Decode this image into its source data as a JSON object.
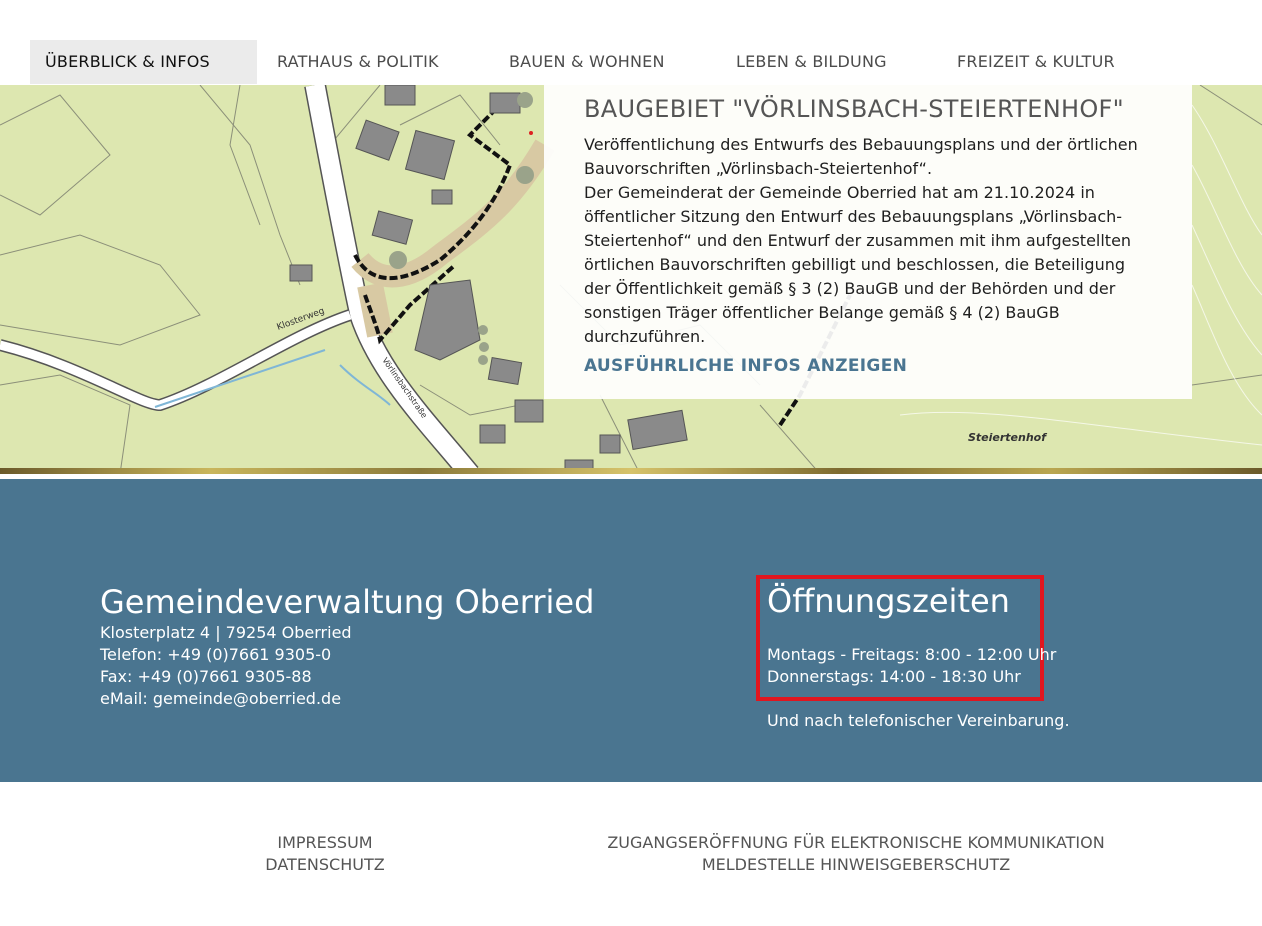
{
  "nav": {
    "items": [
      {
        "label": "ÜBERBLICK & INFOS",
        "active": true
      },
      {
        "label": "RATHAUS & POLITIK"
      },
      {
        "label": "BAUEN & WOHNEN"
      },
      {
        "label": "LEBEN & BILDUNG"
      },
      {
        "label": "FREIZEIT & KULTUR"
      }
    ]
  },
  "hero": {
    "map_labels": {
      "klosterweg": "Klosterweg",
      "voerlinsbachstrasse": "Vörlinsbachstraße",
      "steiertenhof": "Steiertenhof"
    },
    "news": {
      "title": "BAUGEBIET \"VÖRLINSBACH-STEIERTENHOF\"",
      "intro": "Veröffentlichung des Entwurfs des Bebauungsplans und der örtlichen Bauvorschriften „Vörlinsbach-Steiertenhof“.",
      "body": "Der Gemeinderat der Gemeinde Oberried hat am 21.10.2024 in öffentlicher Sitzung den Entwurf des Bebauungsplans „Vörlinsbach-Steiertenhof“ und den Entwurf der zusammen mit ihm aufgestellten örtlichen Bauvorschriften gebilligt und beschlossen, die Beteiligung der Öffentlichkeit gemäß § 3 (2) BauGB und der Behörden und der sonstigen Träger öffentlicher Belange gemäß § 4 (2) BauGB durchzuführen.",
      "link": "AUSFÜHRLICHE INFOS ANZEIGEN"
    }
  },
  "contact": {
    "name": "Gemeindeverwaltung Oberried",
    "address": "Klosterplatz 4 | 79254 Oberried",
    "phone": "Telefon: +49 (0)7661 9305-0",
    "fax": "Fax: +49 (0)7661 9305-88",
    "email": "eMail: gemeinde@oberried.de"
  },
  "hours": {
    "title": "Öffnungszeiten",
    "weekdays": "Montags - Freitags: 8:00 - 12:00 Uhr",
    "thursday": "Donnerstags: 14:00 - 18:30 Uhr",
    "note": "Und nach telefonischer Vereinbarung.",
    "highlight_color": "#e0161f"
  },
  "footer": {
    "left": [
      "IMPRESSUM",
      "DATENSCHUTZ"
    ],
    "right": [
      "ZUGANGSERÖFFNUNG FÜR ELEKTRONISCHE KOMMUNIKATION",
      "MELDESTELLE HINWEISGEBERSCHUTZ"
    ]
  },
  "colors": {
    "band": "#4a7590",
    "link": "#4a7591",
    "nav_active_bg": "#ebebeb"
  }
}
